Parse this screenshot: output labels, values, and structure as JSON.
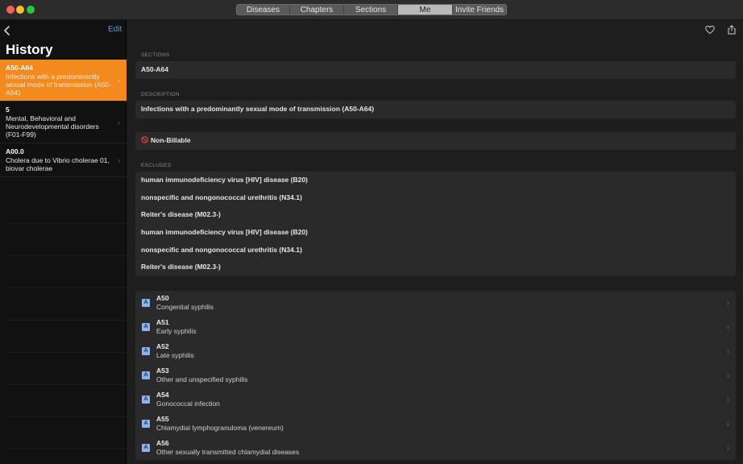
{
  "nav": {
    "tabs": [
      "Diseases",
      "Chapters",
      "Sections",
      "Me",
      "Invite Friends"
    ],
    "active_tab": "Me"
  },
  "sidebar": {
    "edit_label": "Edit",
    "title": "History",
    "items": [
      {
        "code": "A50-A64",
        "description": "Infections with a predominantly sexual mode of transmission (A50-A64)"
      },
      {
        "code": "5",
        "description": "Mental, Behavioral and Neurodevelopmental disorders (F01-F99)"
      },
      {
        "code": "A00.0",
        "description": "Cholera due to Vibrio cholerae 01, biovar cholerae"
      }
    ]
  },
  "detail": {
    "sections_label": "SECTIONS",
    "section_value": "A50-A64",
    "description_label": "DESCRIPTION",
    "description_value": "Infections with a predominantly sexual mode of transmission (A50-A64)",
    "billable_label": "Non-Billable",
    "excludes_label": "EXCLUDES",
    "excludes": [
      "human immunodeficiency virus [HIV] disease (B20)",
      "nonspecific and nongonococcal urethritis (N34.1)",
      "Reiter's disease (M02.3-)",
      "human immunodeficiency virus [HIV] disease (B20)",
      "nonspecific and nongonococcal urethritis (N34.1)",
      "Reiter's disease (M02.3-)"
    ],
    "codes": [
      {
        "badge": "A",
        "code": "A50",
        "name": "Congenital syphilis"
      },
      {
        "badge": "A",
        "code": "A51",
        "name": "Early syphilis"
      },
      {
        "badge": "A",
        "code": "A52",
        "name": "Late syphilis"
      },
      {
        "badge": "A",
        "code": "A53",
        "name": "Other and unspecified syphilis"
      },
      {
        "badge": "A",
        "code": "A54",
        "name": "Gonococcal infection"
      },
      {
        "badge": "A",
        "code": "A55",
        "name": "Chlamydial lymphogranuloma (venereum)"
      },
      {
        "badge": "A",
        "code": "A56",
        "name": "Other sexually transmitted chlamydial diseases"
      }
    ]
  },
  "colors": {
    "accent": "#f28a1d",
    "link": "#4f9cff",
    "badge": "#8fb0e8"
  }
}
